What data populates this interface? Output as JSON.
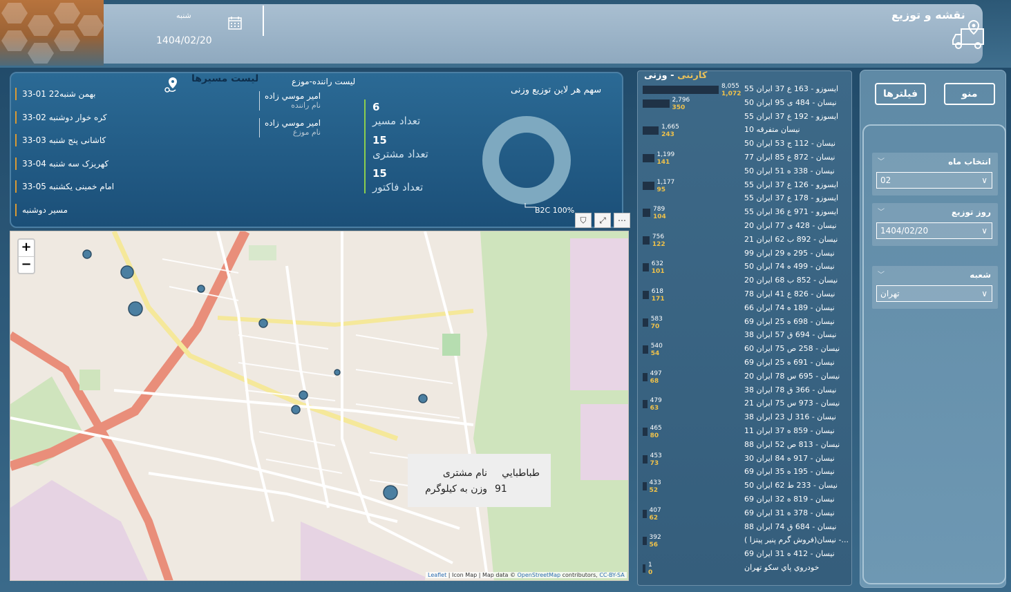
{
  "header": {
    "day": "شنبه",
    "date": "1404/02/20",
    "title": "نقشه و توزیع"
  },
  "summary": {
    "routes_title": "لیست مسیرها",
    "routes": [
      "بهمن شنبه22 01-33",
      "کره خوار دوشنبه 02-33",
      "کاشانی پنج شنبه 03-33",
      "کهریزک سه شنبه 04-33",
      "امام خمینی یکشنبه 05-33",
      "مسیر دوشنبه"
    ],
    "drivers_title": "لیست راننده-موزع",
    "drivers": [
      {
        "name": "امير موسي زاده",
        "role": "نام راننده"
      },
      {
        "name": "امير موسي زاده",
        "role": "نام موزع"
      }
    ],
    "kpis": [
      {
        "value": "6",
        "label": "تعداد مسیر"
      },
      {
        "value": "15",
        "label": "تعداد مشتری"
      },
      {
        "value": "15",
        "label": "تعداد فاکتور"
      }
    ],
    "donut_title": "سهم هر لاین توزیع وزنی",
    "donut_label": "B2C 100%"
  },
  "map": {
    "zoom_in": "+",
    "zoom_out": "−",
    "tooltip": {
      "name_label": "نام مشتری",
      "name_value": "طباطبايي",
      "weight_label": "وزن به کیلوگرم",
      "weight_value": "91"
    },
    "attrib_leaflet": "Leaflet",
    "attrib_rest": " | Icon Map | Map data © ",
    "attrib_osm": "OpenStreetMap",
    "attrib_tail": " contributors, ",
    "attrib_cc": "CC-BY-SA"
  },
  "list": {
    "title_a": "وزنی",
    "title_sep": " - ",
    "title_b": "کارتنی",
    "rows": [
      {
        "label": "ایسوزو - 163 ع 37 ایران 55",
        "v1": "8,055",
        "v2": "1,072",
        "w": 1
      },
      {
        "label": "نیسان - 484 ی 95 ایران 50",
        "v1": "2,796",
        "v2": "350",
        "w": 0.35
      },
      {
        "label": "ایسوزو - 192 ع 37 ایران 55",
        "v1": "",
        "v2": "",
        "w": 0
      },
      {
        "label": "نیسان متفرقه 10",
        "v1": "1,665",
        "v2": "243",
        "w": 0.21
      },
      {
        "label": "نیسان - 112 ج 53 ایران 50",
        "v1": "",
        "v2": "",
        "w": 0
      },
      {
        "label": "نیسان - 872 ع 85 ایران 77",
        "v1": "1,199",
        "v2": "141",
        "w": 0.15
      },
      {
        "label": "نیسان - 338 ه 51 ایران 50",
        "v1": "",
        "v2": "",
        "w": 0
      },
      {
        "label": "ایسوزو - 126 ع 37 ایران 55",
        "v1": "1,177",
        "v2": "95",
        "w": 0.15
      },
      {
        "label": "ایسوزو - 178 ع 37 ایران 55",
        "v1": "",
        "v2": "",
        "w": 0
      },
      {
        "label": "ایسوزو - 971 ع 36 ایران 55",
        "v1": "789",
        "v2": "104",
        "w": 0.1
      },
      {
        "label": "نیسان - 428 ی 77 ایران 20",
        "v1": "",
        "v2": "",
        "w": 0
      },
      {
        "label": "نیسان - 892 ب 62 ایران 21",
        "v1": "756",
        "v2": "122",
        "w": 0.09
      },
      {
        "label": "نیسان - 295 ه 29 ایران 99",
        "v1": "",
        "v2": "",
        "w": 0
      },
      {
        "label": "نیسان - 499 ه 74 ایران 50",
        "v1": "632",
        "v2": "101",
        "w": 0.08
      },
      {
        "label": "نیسان - 852 ب 68 ایران 20",
        "v1": "",
        "v2": "",
        "w": 0
      },
      {
        "label": "نیسان - 826 ع 41 ایران 78",
        "v1": "618",
        "v2": "171",
        "w": 0.08
      },
      {
        "label": "نیسان - 189 ه 74 ایران 66",
        "v1": "",
        "v2": "",
        "w": 0
      },
      {
        "label": "نیسان - 698 ه 25 ایران 69",
        "v1": "583",
        "v2": "70",
        "w": 0.07
      },
      {
        "label": "نیسان - 694 ق 57 ایران 38",
        "v1": "",
        "v2": "",
        "w": 0
      },
      {
        "label": "نیسان - 258 ص 75 ایران 60",
        "v1": "540",
        "v2": "54",
        "w": 0.07
      },
      {
        "label": "نیسان - 691 ه 25 ایران 69",
        "v1": "",
        "v2": "",
        "w": 0
      },
      {
        "label": "نیسان - 695 س 78 ایران 20",
        "v1": "497",
        "v2": "68",
        "w": 0.06
      },
      {
        "label": "نیسان - 366 ق 78 ایران 38",
        "v1": "",
        "v2": "",
        "w": 0
      },
      {
        "label": "نیسان - 973 س 75 ایران 21",
        "v1": "479",
        "v2": "63",
        "w": 0.06
      },
      {
        "label": "نیسان - 316 ل 23 ایران 38",
        "v1": "",
        "v2": "",
        "w": 0
      },
      {
        "label": "نیسان - 859 ه 37 ایران 11",
        "v1": "465",
        "v2": "80",
        "w": 0.06
      },
      {
        "label": "نیسان - 813 ص 52 ایران 88",
        "v1": "",
        "v2": "",
        "w": 0
      },
      {
        "label": "نیسان - 917 ه 84 ایران 30",
        "v1": "453",
        "v2": "73",
        "w": 0.06
      },
      {
        "label": "نیسان - 195 ه 35 ایران 69",
        "v1": "",
        "v2": "",
        "w": 0
      },
      {
        "label": "نیسان - 233 ط 62 ایران 50",
        "v1": "433",
        "v2": "52",
        "w": 0.05
      },
      {
        "label": "نیسان - 819 ه 32 ایران 69",
        "v1": "",
        "v2": "",
        "w": 0
      },
      {
        "label": "نیسان - 378 ه 31 ایران 69",
        "v1": "407",
        "v2": "62",
        "w": 0.05
      },
      {
        "label": "نیسان - 684 ق 74 ایران 88",
        "v1": "",
        "v2": "",
        "w": 0
      },
      {
        "label": "نیسان(فروش گرم پنیر پیتزا ) -...",
        "v1": "392",
        "v2": "56",
        "w": 0.05
      },
      {
        "label": "نیسان - 412 ه 31 ایران 69",
        "v1": "",
        "v2": "",
        "w": 0
      },
      {
        "label": "خودروي پاي سكو تهران",
        "v1": "1",
        "v2": "0",
        "w": 0
      }
    ]
  },
  "filters": {
    "menu": "منو",
    "filters_btn": "فیلترها",
    "groups": [
      {
        "title": "انتخاب ماه",
        "value": "02"
      },
      {
        "title": "روز توزیع",
        "value": "1404/02/20"
      },
      {
        "title": "شعبه",
        "value": "تهران"
      }
    ]
  }
}
